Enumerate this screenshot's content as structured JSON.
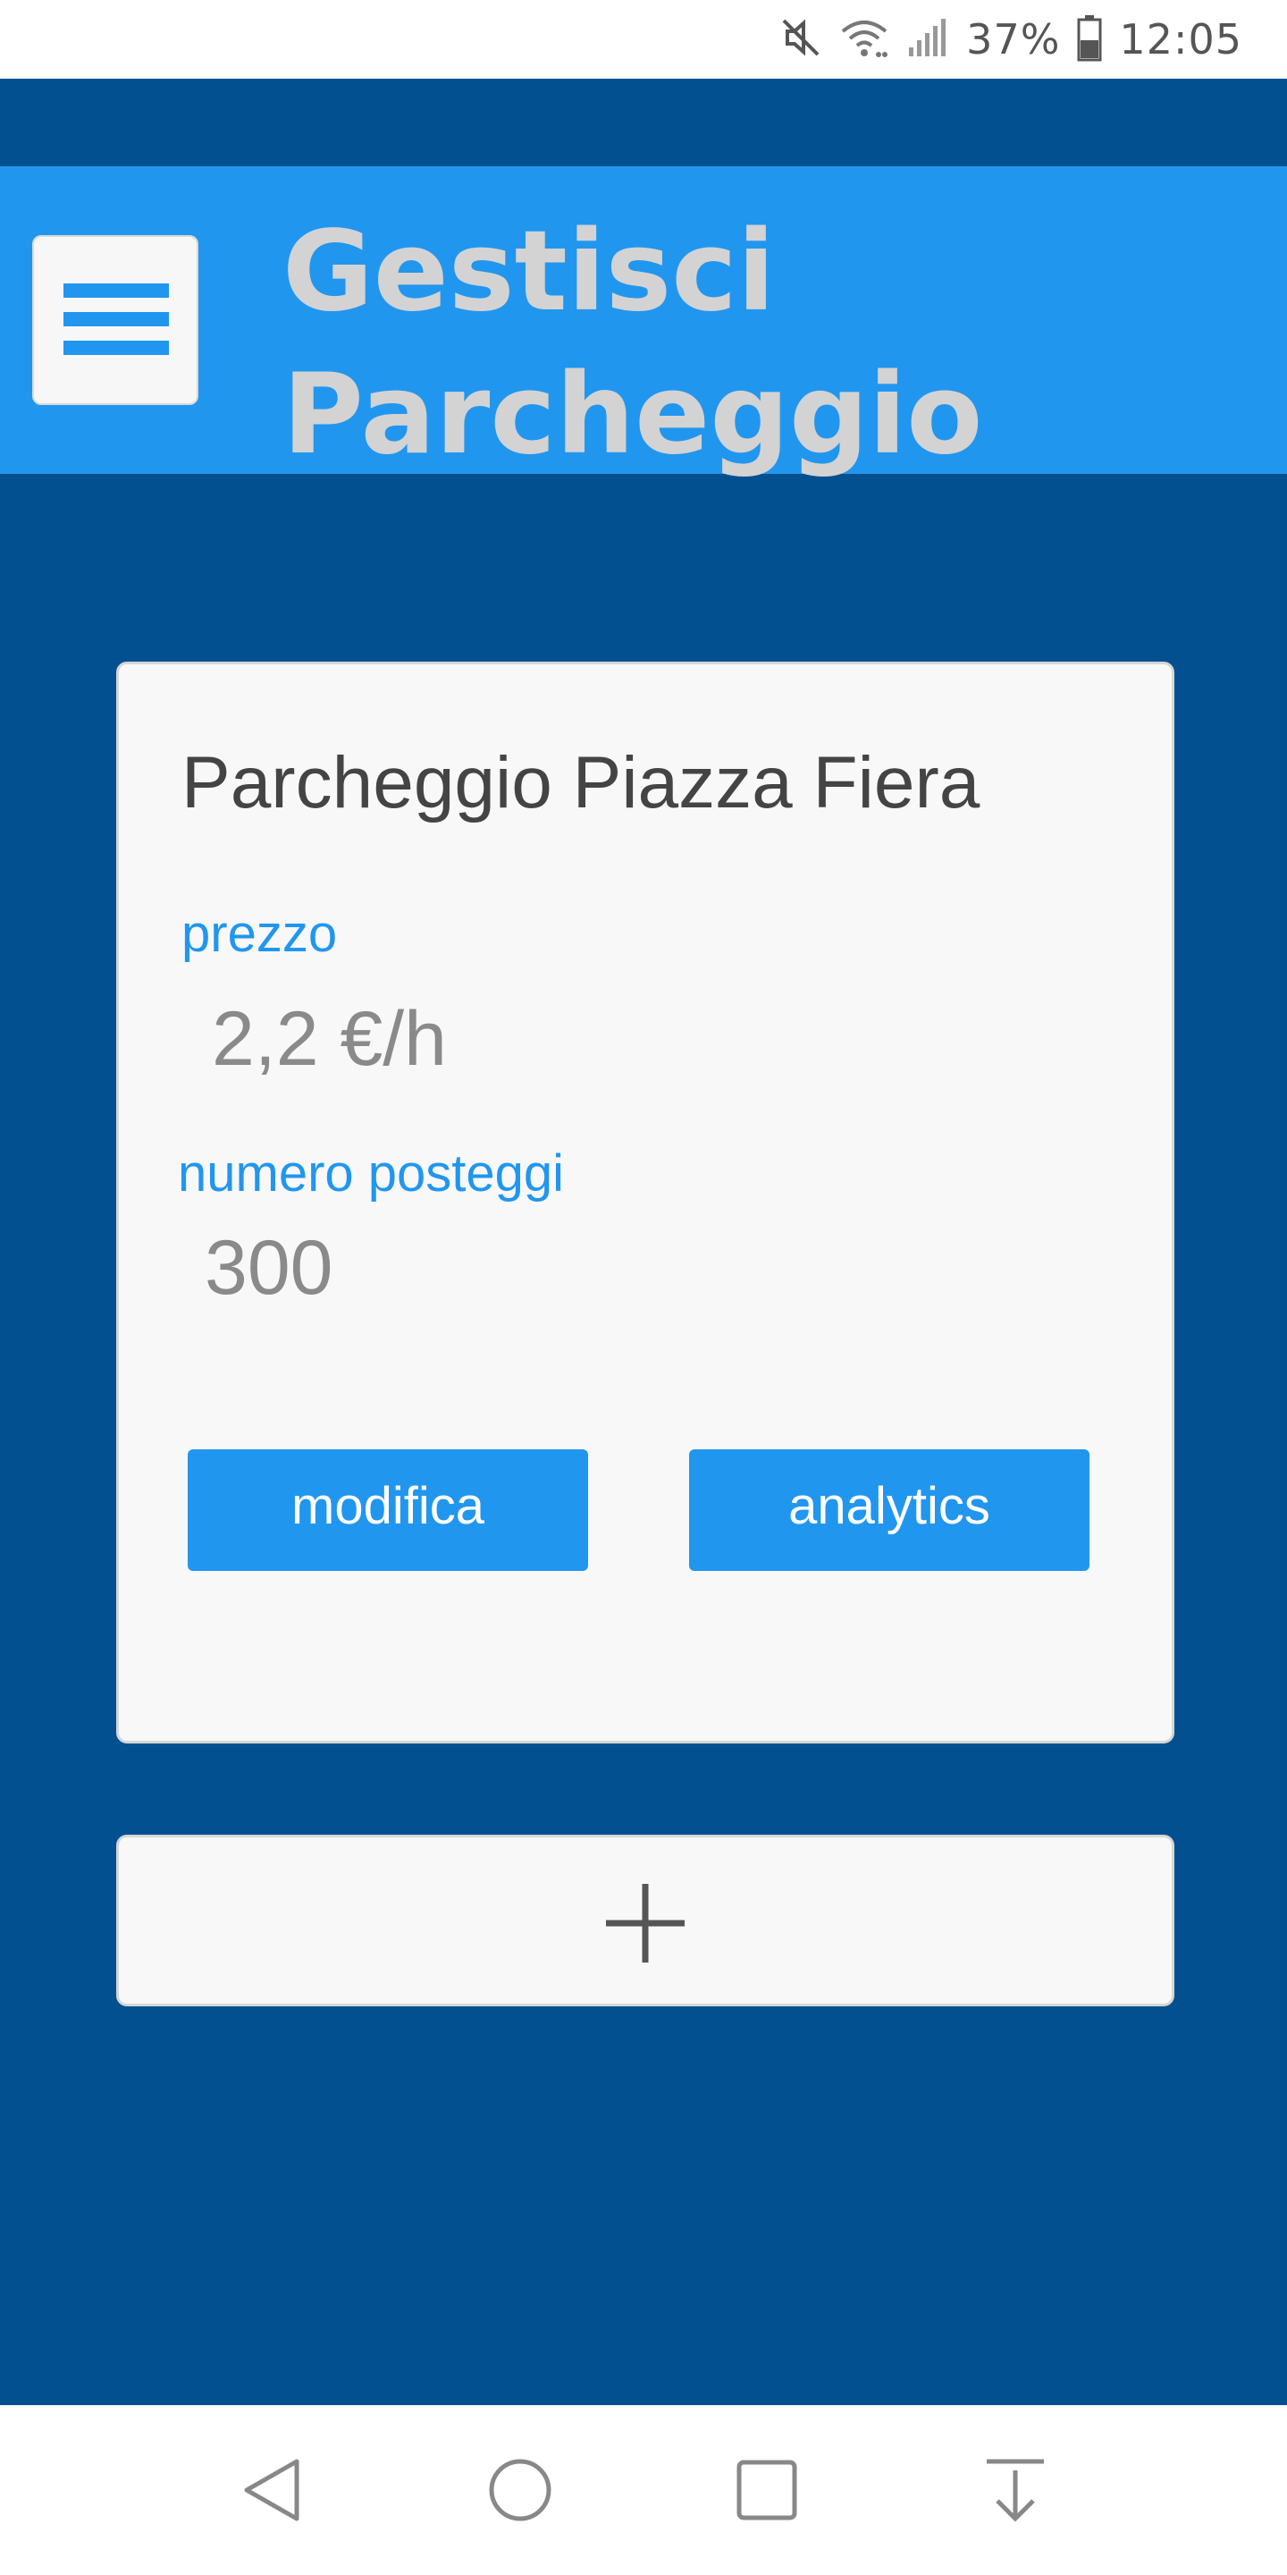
{
  "status_bar": {
    "battery": "37%",
    "time": "12:05",
    "icons": [
      "mute-icon",
      "wifi-icon",
      "signal-icon",
      "battery-icon"
    ]
  },
  "header": {
    "title": "Gestisci Parcheggio",
    "menu_icon": "hamburger-menu-icon"
  },
  "parking": {
    "name": "Parcheggio Piazza Fiera",
    "price_label": "prezzo",
    "price_value": "2,2 €/h",
    "spots_label": "numero posteggi",
    "spots_value": "300",
    "edit_button": "modifica",
    "analytics_button": "analytics"
  },
  "add_card": {
    "icon": "plus-icon"
  },
  "nav_bar": {
    "icons": [
      "back-icon",
      "home-icon",
      "recents-icon",
      "notifications-down-icon"
    ]
  },
  "colors": {
    "background": "#02508f",
    "accent": "#2196ef",
    "title_text": "#d3d3d3",
    "card": "#f8f8f8"
  }
}
